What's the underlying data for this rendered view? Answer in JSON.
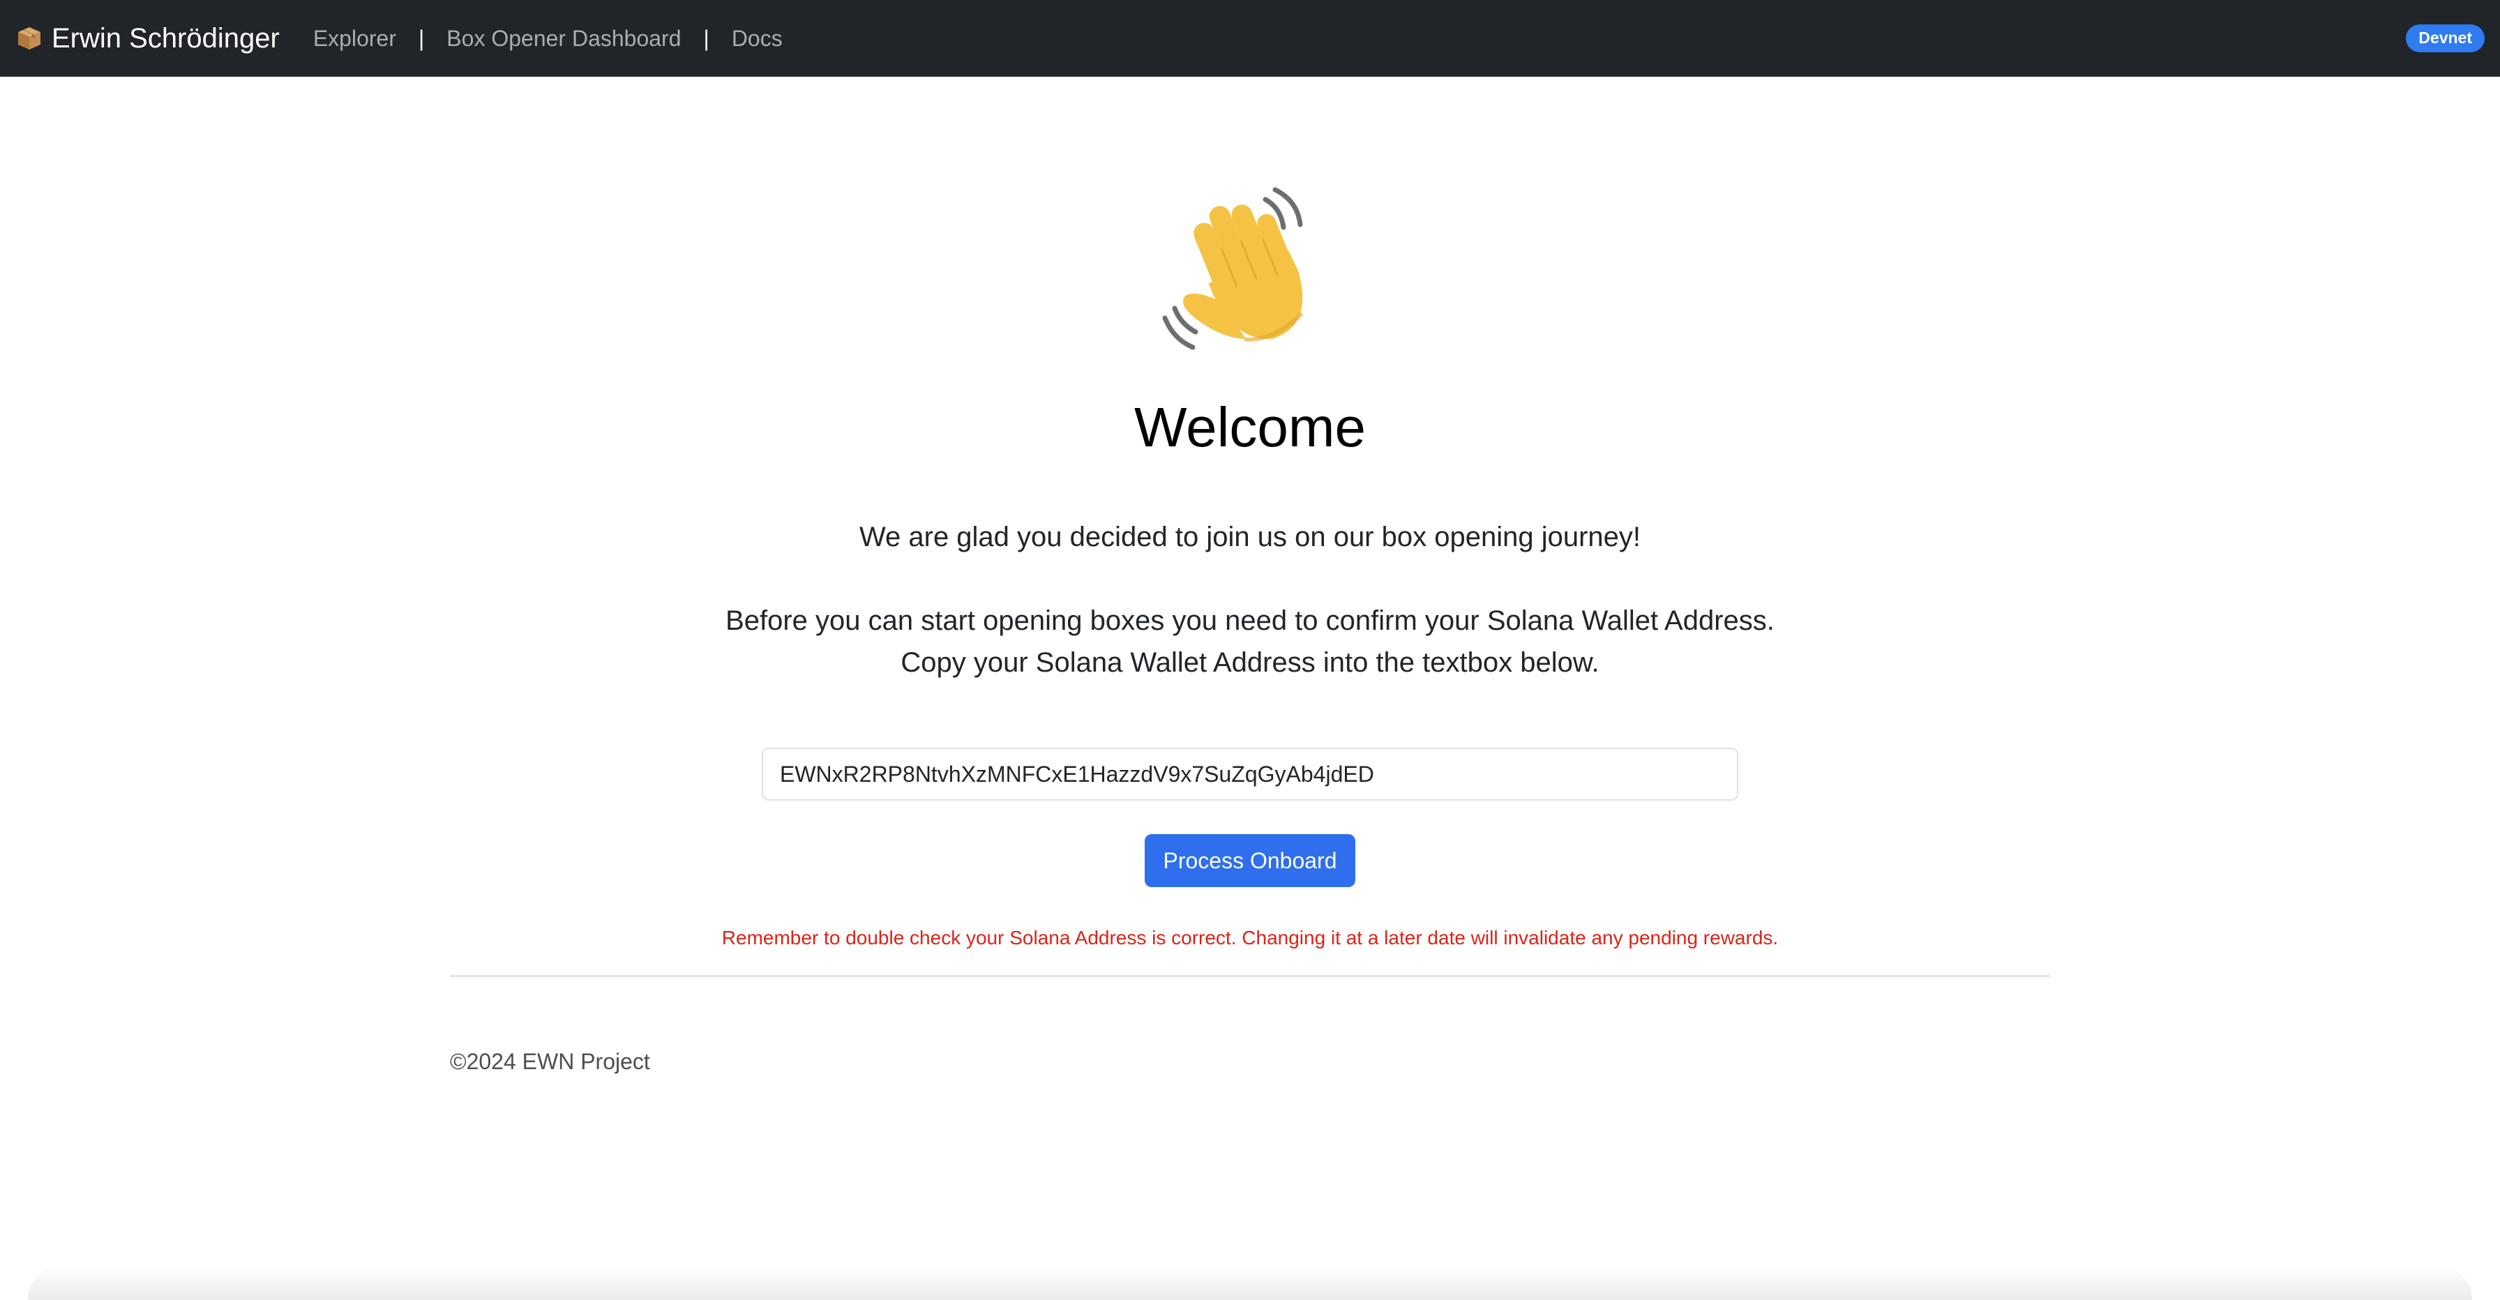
{
  "nav": {
    "brand": "Erwin Schrödinger",
    "brand_icon": "package-icon",
    "links": [
      {
        "label": "Explorer"
      },
      {
        "label": "Box Opener Dashboard"
      },
      {
        "label": "Docs"
      }
    ],
    "separator": "|",
    "network_badge": "Devnet"
  },
  "main": {
    "hero_icon": "waving-hand-icon",
    "title": "Welcome",
    "intro": "We are glad you decided to join us on our box opening journey!",
    "instruction_line1": "Before you can start opening boxes you need to confirm your Solana Wallet Address.",
    "instruction_line2": "Copy your Solana Wallet Address into the textbox below.",
    "wallet_input_value": "EWNxR2RP8NtvhXzMNFCxE1HazzdV9x7SuZqGyAb4jdED",
    "submit_label": "Process Onboard",
    "warning": "Remember to double check your Solana Address is correct. Changing it at a later date will invalidate any pending rewards."
  },
  "footer": {
    "copyright": "©2024 EWN Project"
  },
  "colors": {
    "navbar": "#212529",
    "primary": "#2f6fed",
    "badge": "#2f7bf0",
    "warning": "#dc2318",
    "hand": "#f6c244"
  }
}
